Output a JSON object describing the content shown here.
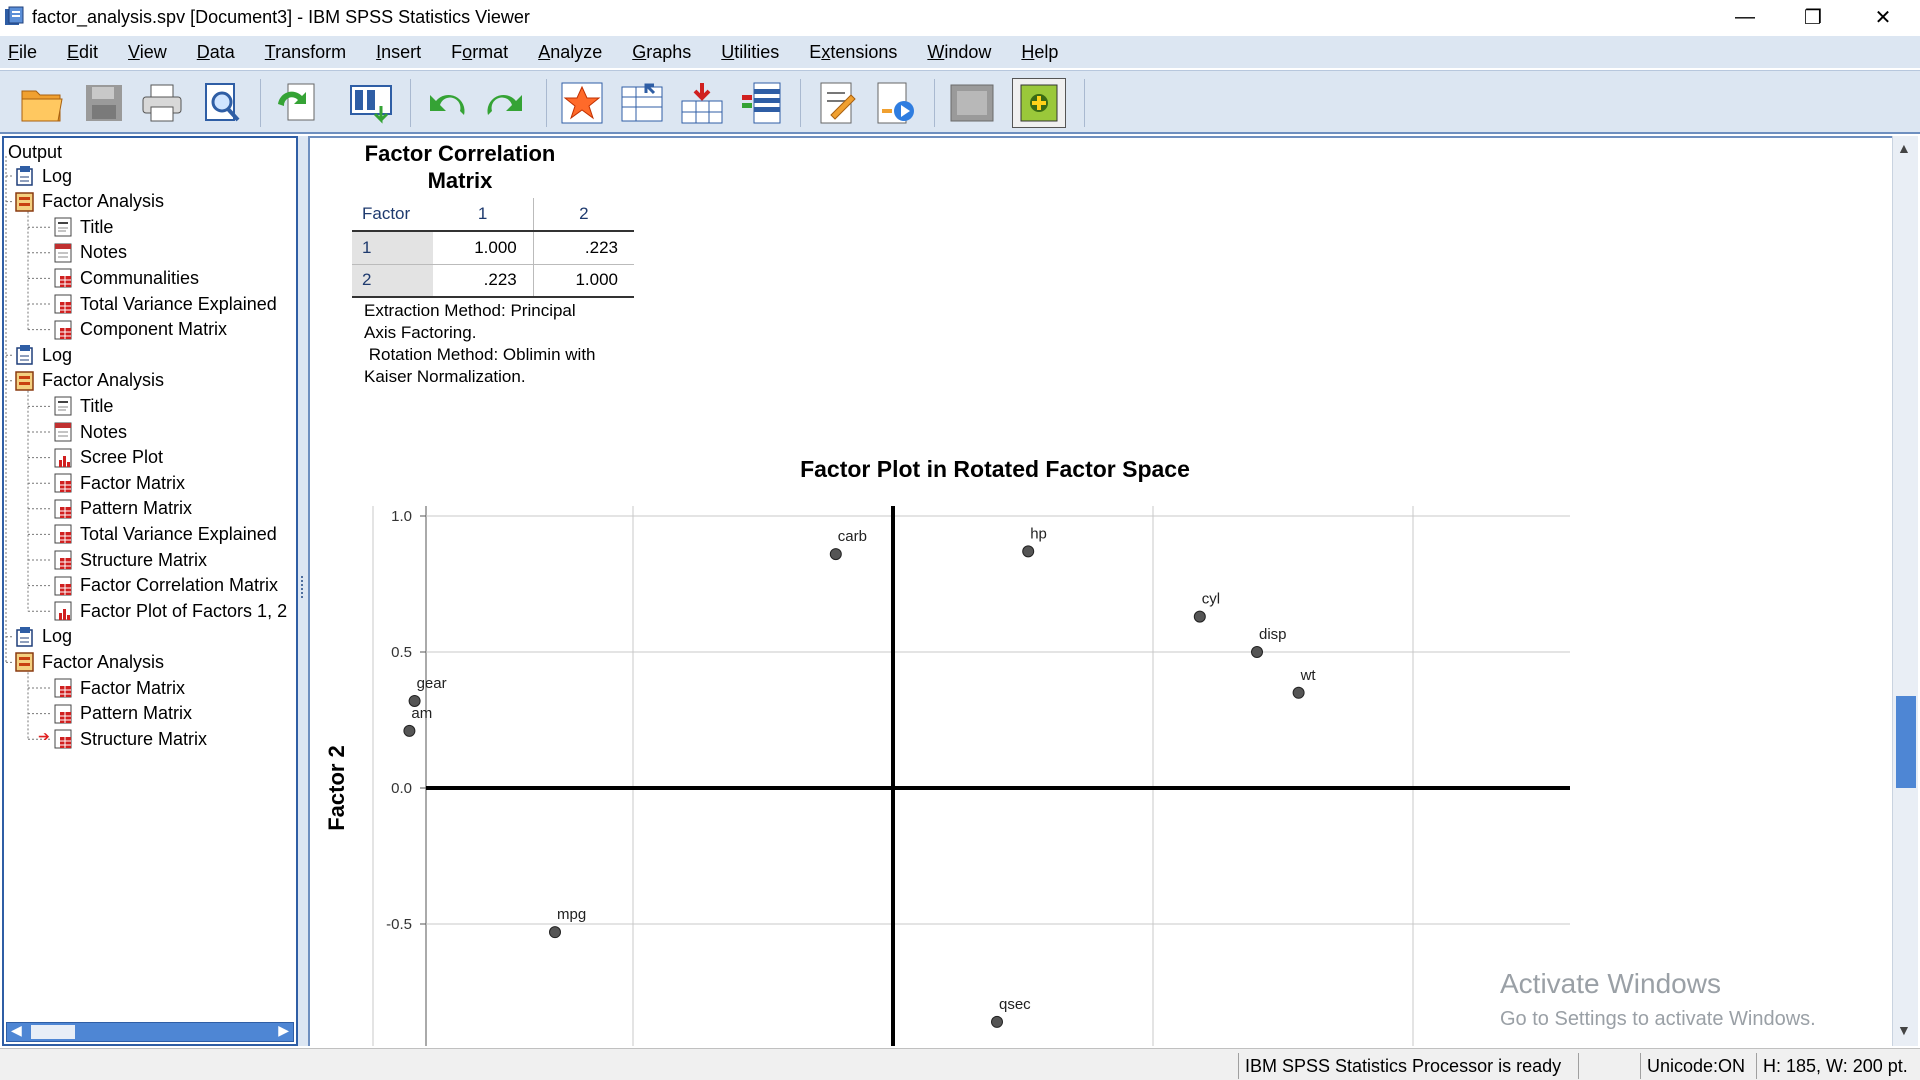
{
  "window": {
    "title": "factor_analysis.spv [Document3] - IBM SPSS Statistics Viewer",
    "minimize": "—",
    "restore": "❐",
    "close": "✕"
  },
  "menu": [
    {
      "label": "File",
      "key": "F"
    },
    {
      "label": "Edit",
      "key": "E"
    },
    {
      "label": "View",
      "key": "V"
    },
    {
      "label": "Data",
      "key": "D"
    },
    {
      "label": "Transform",
      "key": "T"
    },
    {
      "label": "Insert",
      "key": "I"
    },
    {
      "label": "Format",
      "key": "o"
    },
    {
      "label": "Analyze",
      "key": "A"
    },
    {
      "label": "Graphs",
      "key": "G"
    },
    {
      "label": "Utilities",
      "key": "U"
    },
    {
      "label": "Extensions",
      "key": "x"
    },
    {
      "label": "Window",
      "key": "W"
    },
    {
      "label": "Help",
      "key": "H"
    }
  ],
  "toolbar": {
    "icons": [
      "open-folder-icon",
      "save-icon",
      "print-icon",
      "print-preview-icon",
      "export-icon",
      "recall-dialog-icon",
      "undo-icon",
      "redo-icon",
      "goto-data-icon",
      "goto-case-icon",
      "goto-variable-icon",
      "variables-icon",
      "designate-window-icon",
      "insert-heading-icon",
      "insert-output-icon",
      "hide-icon",
      "promote-icon"
    ]
  },
  "outline": {
    "root": "Output",
    "items": [
      {
        "label": "Log",
        "level": 1,
        "icon": "log-icon"
      },
      {
        "label": "Factor Analysis",
        "level": 1,
        "icon": "factor-analysis-icon"
      },
      {
        "label": "Title",
        "level": 2,
        "icon": "title-icon"
      },
      {
        "label": "Notes",
        "level": 2,
        "icon": "notes-icon"
      },
      {
        "label": "Communalities",
        "level": 2,
        "icon": "table-icon"
      },
      {
        "label": "Total Variance Explained",
        "level": 2,
        "icon": "table-icon"
      },
      {
        "label": "Component Matrix",
        "level": 2,
        "icon": "table-icon"
      },
      {
        "label": "Log",
        "level": 1,
        "icon": "log-icon"
      },
      {
        "label": "Factor Analysis",
        "level": 1,
        "icon": "factor-analysis-icon"
      },
      {
        "label": "Title",
        "level": 2,
        "icon": "title-icon"
      },
      {
        "label": "Notes",
        "level": 2,
        "icon": "notes-icon"
      },
      {
        "label": "Scree Plot",
        "level": 2,
        "icon": "chart-icon"
      },
      {
        "label": "Factor Matrix",
        "level": 2,
        "icon": "table-icon"
      },
      {
        "label": "Pattern Matrix",
        "level": 2,
        "icon": "table-icon"
      },
      {
        "label": "Total Variance Explained",
        "level": 2,
        "icon": "table-icon"
      },
      {
        "label": "Structure Matrix",
        "level": 2,
        "icon": "table-icon"
      },
      {
        "label": "Factor Correlation Matrix",
        "level": 2,
        "icon": "table-icon"
      },
      {
        "label": "Factor Plot of Factors 1, 2",
        "level": 2,
        "icon": "chart-icon"
      },
      {
        "label": "Log",
        "level": 1,
        "icon": "log-icon"
      },
      {
        "label": "Factor Analysis",
        "level": 1,
        "icon": "factor-analysis-icon"
      },
      {
        "label": "Factor Matrix",
        "level": 2,
        "icon": "table-icon"
      },
      {
        "label": "Pattern Matrix",
        "level": 2,
        "icon": "table-icon"
      },
      {
        "label": "Structure Matrix",
        "level": 2,
        "icon": "table-icon",
        "current": true
      }
    ]
  },
  "corr_table": {
    "title_line1": "Factor Correlation",
    "title_line2": "Matrix",
    "header": [
      "Factor",
      "1",
      "2"
    ],
    "rows": [
      [
        "1",
        "1.000",
        ".223"
      ],
      [
        "2",
        ".223",
        "1.000"
      ]
    ],
    "footnote_line1": "Extraction Method: Principal",
    "footnote_line2": "Axis Factoring.",
    "footnote_line3": " Rotation Method: Oblimin with",
    "footnote_line4": "Kaiser Normalization."
  },
  "chart_data": {
    "type": "scatter",
    "title": "Factor Plot in Rotated Factor Space",
    "xlabel": "",
    "ylabel": "Factor 2",
    "ylim": [
      -0.92,
      1.1
    ],
    "xlim": [
      -1.1,
      1.1
    ],
    "yticks": [
      "1.0",
      "0.5",
      "0.0",
      "-0.5"
    ],
    "ytick_values": [
      1.0,
      0.5,
      0.0,
      -0.5
    ],
    "xgrid": [
      -1.0,
      -0.5,
      0.5,
      1.0
    ],
    "grid": true,
    "points": [
      {
        "label": "carb",
        "x": -0.11,
        "y": 0.86
      },
      {
        "label": "hp",
        "x": 0.26,
        "y": 0.87
      },
      {
        "label": "cyl",
        "x": 0.59,
        "y": 0.63
      },
      {
        "label": "disp",
        "x": 0.7,
        "y": 0.5
      },
      {
        "label": "wt",
        "x": 0.78,
        "y": 0.35
      },
      {
        "label": "gear",
        "x": -0.92,
        "y": 0.32
      },
      {
        "label": "am",
        "x": -0.93,
        "y": 0.21
      },
      {
        "label": "mpg",
        "x": -0.65,
        "y": -0.53
      },
      {
        "label": "qsec",
        "x": 0.2,
        "y": -0.86
      }
    ]
  },
  "watermark": {
    "line1": "Activate Windows",
    "line2": "Go to Settings to activate Windows."
  },
  "status": {
    "processor": "IBM SPSS Statistics Processor is ready",
    "unicode": "Unicode:ON",
    "size": "H: 185, W: 200 pt."
  }
}
